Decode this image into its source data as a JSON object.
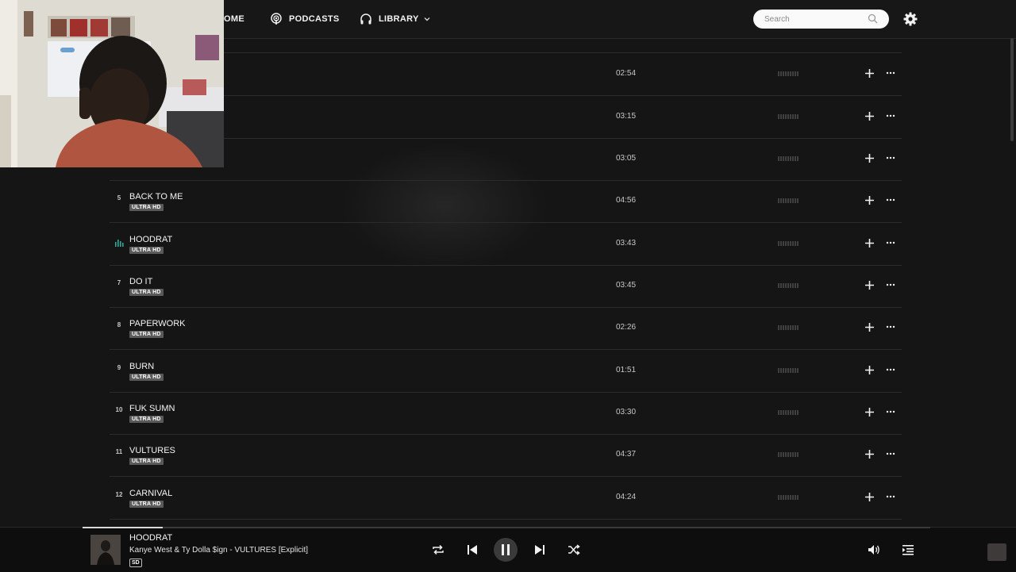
{
  "nav": {
    "home_label": "OME",
    "podcasts_label": "PODCASTS",
    "library_label": "LIBRARY",
    "search_placeholder": "Search"
  },
  "tracks": [
    {
      "num": "",
      "title": "",
      "badge": "",
      "duration": "02:54"
    },
    {
      "num": "",
      "title": "",
      "badge": "",
      "duration": "03:15"
    },
    {
      "num": "",
      "title": "",
      "badge": "",
      "duration": "03:05"
    },
    {
      "num": "5",
      "title": "BACK TO ME",
      "badge": "ULTRA HD",
      "duration": "04:56"
    },
    {
      "num": "",
      "title": "HOODRAT",
      "badge": "ULTRA HD",
      "duration": "03:43",
      "playing": true
    },
    {
      "num": "7",
      "title": "DO IT",
      "badge": "ULTRA HD",
      "duration": "03:45"
    },
    {
      "num": "8",
      "title": "PAPERWORK",
      "badge": "ULTRA HD",
      "duration": "02:26"
    },
    {
      "num": "9",
      "title": "BURN",
      "badge": "ULTRA HD",
      "duration": "01:51"
    },
    {
      "num": "10",
      "title": "FUK SUMN",
      "badge": "ULTRA HD",
      "duration": "03:30"
    },
    {
      "num": "11",
      "title": "VULTURES",
      "badge": "ULTRA HD",
      "duration": "04:37"
    },
    {
      "num": "12",
      "title": "CARNIVAL",
      "badge": "ULTRA HD",
      "duration": "04:24"
    }
  ],
  "player": {
    "title": "HOODRAT",
    "artist_album": "Kanye West & Ty Dolla $ign - VULTURES [Explicit]",
    "quality_badge": "SD",
    "progress_fraction": 0.095
  },
  "colors": {
    "background": "#151515",
    "badge_bg": "#5a5a5a",
    "playing_indicator": "#2fa89a"
  },
  "icons": [
    "podcast-icon",
    "headphones-icon",
    "chevron-down-icon",
    "search-icon",
    "gear-icon",
    "plus-icon",
    "more-icon",
    "repeat-icon",
    "previous-icon",
    "pause-icon",
    "next-icon",
    "shuffle-icon",
    "volume-icon",
    "queue-icon",
    "equalizer-icon"
  ]
}
